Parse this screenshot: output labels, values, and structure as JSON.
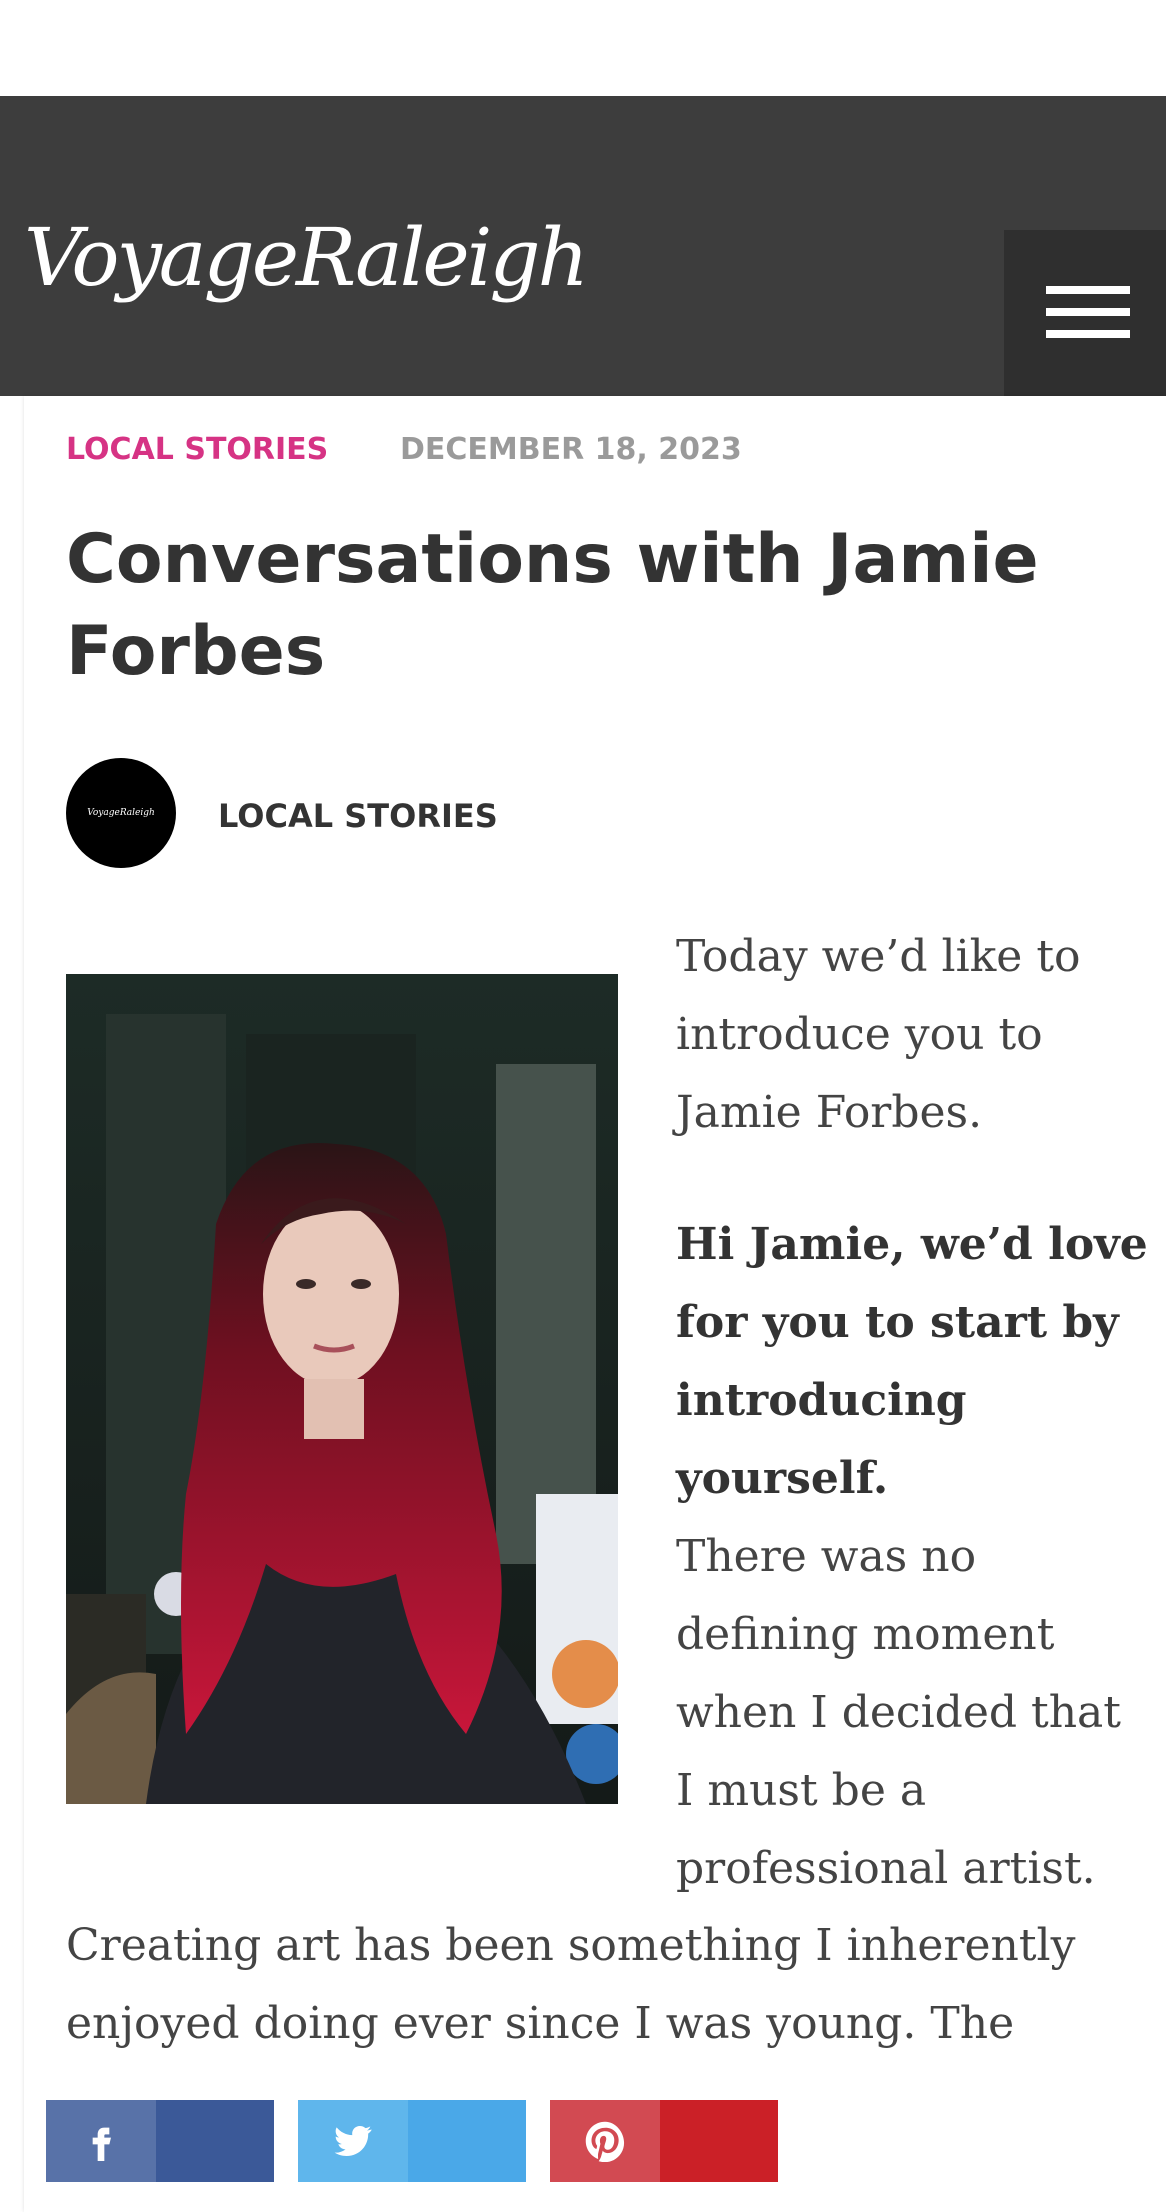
{
  "header": {
    "logo": "VoyageRaleigh",
    "menu_icon": "hamburger-menu-icon"
  },
  "article": {
    "category": "LOCAL STORIES",
    "date": "DECEMBER 18, 2023",
    "title": "Conversations with Jamie Forbes",
    "author_avatar_text": "VoyageRaleigh",
    "author": "LOCAL STORIES",
    "intro_lines": [
      "Today we’d like to",
      "introduce you to",
      "Jamie Forbes."
    ],
    "question_lines": [
      "Hi Jamie, we’d love",
      "for you to start by",
      "introducing",
      "yourself."
    ],
    "answer_lines": [
      "There was no",
      "defining moment",
      "when I decided that",
      "I must be a",
      "professional artist."
    ],
    "continued_lines": [
      "Creating art has been something I inherently",
      "enjoyed doing ever since I was young. The"
    ]
  },
  "share": {
    "facebook": {
      "icon": "facebook-icon",
      "color": "#3b5998"
    },
    "twitter": {
      "icon": "twitter-icon",
      "color": "#4aa8e8"
    },
    "pinterest": {
      "icon": "pinterest-icon",
      "color": "#cb2027"
    }
  },
  "colors": {
    "header_bg": "#3d3d3d",
    "category_accent": "#d63384",
    "date_gray": "#9a9a9a"
  }
}
